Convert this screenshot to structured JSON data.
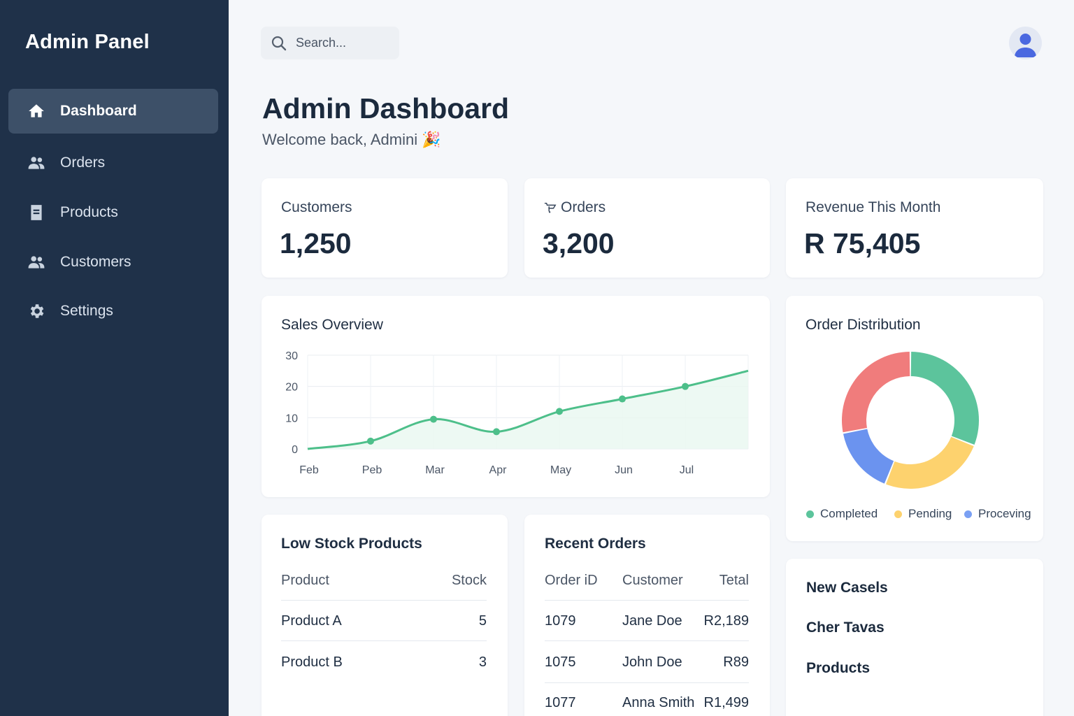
{
  "sidebar": {
    "brand": "Admin Panel",
    "items": [
      {
        "label": "Dashboard",
        "icon": "home-icon",
        "active": true
      },
      {
        "label": "Orders",
        "icon": "users-icon"
      },
      {
        "label": "Products",
        "icon": "document-icon"
      },
      {
        "label": "Customers",
        "icon": "users-icon"
      },
      {
        "label": "Settings",
        "icon": "gear-icon"
      }
    ]
  },
  "search": {
    "placeholder": "Search..."
  },
  "header": {
    "title": "Admin Dashboard",
    "welcome": "Welcome back, Admini 🎉"
  },
  "stats": [
    {
      "label": "Customers",
      "value": "1,250"
    },
    {
      "label": "Orders",
      "value": "3,200",
      "icon": "cart-icon"
    },
    {
      "label": "Revenue This Month",
      "value": "R 75,405"
    }
  ],
  "sales_overview": {
    "title": "Sales Overview"
  },
  "order_distribution": {
    "title": "Order Distribution",
    "legend": [
      {
        "label": "Completed",
        "color": "#5cc49c"
      },
      {
        "label": "Pending",
        "color": "#fdd26e"
      },
      {
        "label": "Proceving",
        "color": "#7aa0f3"
      }
    ]
  },
  "low_stock": {
    "title": "Low Stock Products",
    "headers": [
      "Product",
      "Stock"
    ],
    "rows": [
      [
        "Product A",
        "5"
      ],
      [
        "Product B",
        "3"
      ]
    ]
  },
  "recent_orders": {
    "title": "Recent Orders",
    "headers": [
      "Order iD",
      "Customer",
      "Tetal"
    ],
    "rows": [
      [
        "1079",
        "Jane Doe",
        "R2,189"
      ],
      [
        "1075",
        "John Doe",
        "R89"
      ],
      [
        "1077",
        "Anna Smith",
        "R1,499"
      ]
    ]
  },
  "new_cases": {
    "items": [
      "New Casels",
      "Cher Tavas",
      "Products"
    ]
  },
  "chart_data": [
    {
      "type": "area",
      "title": "Sales Overview",
      "x": [
        "Feb",
        "Peb",
        "Mar",
        "Apr",
        "May",
        "Jun",
        "Jul"
      ],
      "series": [
        {
          "values": [
            2.5,
            9.5,
            5.5,
            12,
            16,
            20
          ]
        }
      ],
      "points": [
        [
          0,
          0
        ],
        [
          1,
          2.5
        ],
        [
          2,
          9.5
        ],
        [
          3,
          5.5
        ],
        [
          4,
          12
        ],
        [
          5,
          16
        ],
        [
          6,
          20
        ],
        [
          7,
          25
        ]
      ],
      "yticks": [
        "0",
        "10",
        "20",
        "30"
      ],
      "ylim": [
        0,
        30
      ],
      "grid": true,
      "color": "#4dbf8a"
    },
    {
      "type": "pie",
      "title": "Order Distribution",
      "donut": true,
      "slices": [
        {
          "label": "Completed",
          "value": 31,
          "color": "#5cc49c"
        },
        {
          "label": "Pending",
          "value": 25,
          "color": "#fdd26e"
        },
        {
          "label": "Proceving",
          "value": 16,
          "color": "#6b93ef"
        },
        {
          "label": "",
          "value": 28,
          "color": "#f07c7c"
        }
      ],
      "legend": "bottom"
    }
  ]
}
